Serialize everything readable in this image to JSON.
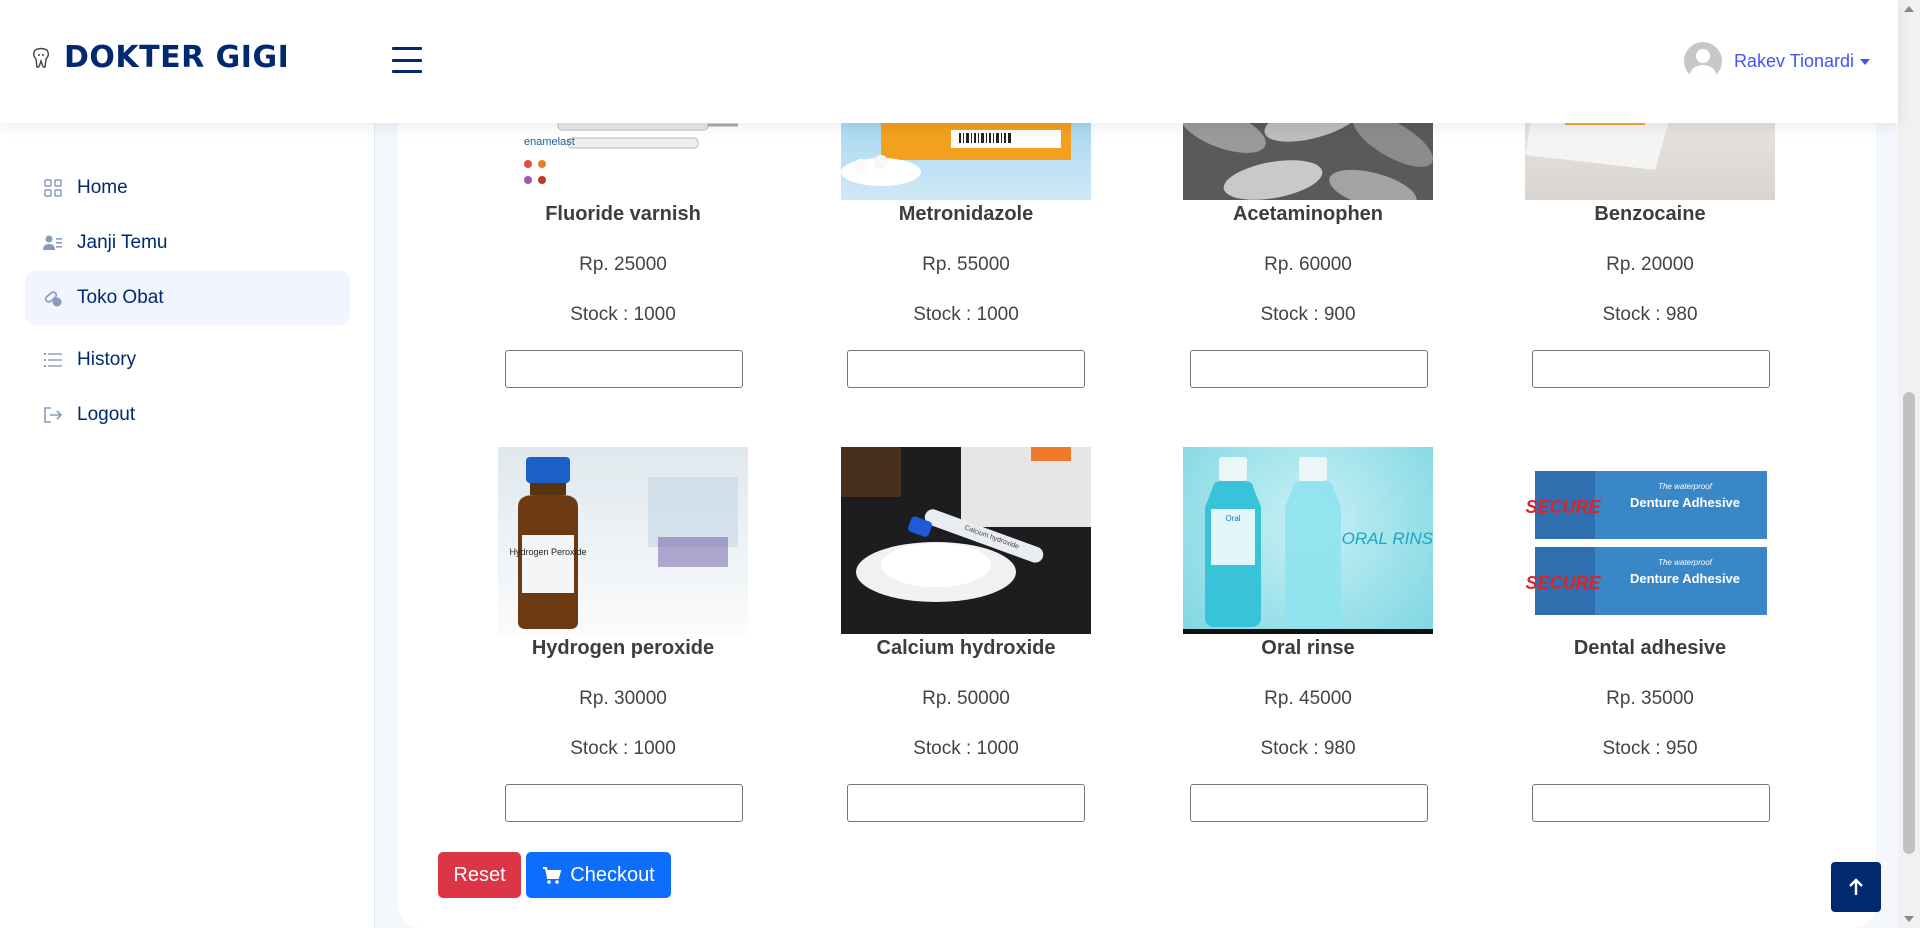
{
  "header": {
    "brand": "DOKTER GIGI",
    "user_name": "Rakev Tionardi"
  },
  "sidebar": {
    "items": [
      {
        "label": "Home",
        "icon": "grid-icon"
      },
      {
        "label": "Janji Temu",
        "icon": "person-list-icon"
      },
      {
        "label": "Toko Obat",
        "icon": "capsule-icon",
        "active": true
      },
      {
        "label": "History",
        "icon": "list-icon"
      },
      {
        "label": "Logout",
        "icon": "logout-icon"
      }
    ]
  },
  "products_row1": [
    {
      "name": "Fluoride varnish",
      "price": "Rp. 25000",
      "stock": "Stock : 1000"
    },
    {
      "name": "Metronidazole",
      "price": "Rp. 55000",
      "stock": "Stock : 1000"
    },
    {
      "name": "Acetaminophen",
      "price": "Rp. 60000",
      "stock": "Stock : 900"
    },
    {
      "name": "Benzocaine",
      "price": "Rp. 20000",
      "stock": "Stock : 980"
    }
  ],
  "products_row2": [
    {
      "name": "Hydrogen peroxide",
      "price": "Rp. 30000",
      "stock": "Stock : 1000"
    },
    {
      "name": "Calcium hydroxide",
      "price": "Rp. 50000",
      "stock": "Stock : 1000"
    },
    {
      "name": "Oral rinse",
      "price": "Rp. 45000",
      "stock": "Stock : 980"
    },
    {
      "name": "Dental adhesive",
      "price": "Rp. 35000",
      "stock": "Stock : 950"
    }
  ],
  "image_text": {
    "fluoride": "enamelast",
    "hydrogen": "Hydrogen Peroxide",
    "calcium": "Calcium hydroxide",
    "oral_brand": "Oral",
    "oral_title": "ORAL RINSE",
    "adhesive_brand": "SECURE",
    "adhesive_title": "Denture Adhesive",
    "adhesive_tag": "The waterproof"
  },
  "actions": {
    "reset": "Reset",
    "checkout": "Checkout"
  }
}
